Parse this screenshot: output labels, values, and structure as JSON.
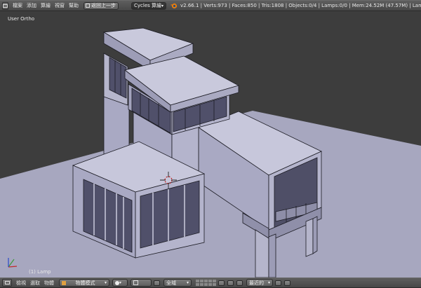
{
  "top_menu": {
    "items": [
      "檔案",
      "添加",
      "算繪",
      "視窗",
      "幫助"
    ],
    "back_label": "返回上一步",
    "engine_label": "Cycles 算繪",
    "stats": "v2.66.1 | Verts:973 | Faces:850 | Tris:1808 | Objects:0/4 | Lamps:0/0 | Mem:24.52M (47.57M) | Lamp"
  },
  "viewport": {
    "view_name": "User Ortho",
    "active_object": "(1) Lamp"
  },
  "bottom_menu": {
    "items": [
      "檢視",
      "選取",
      "物體"
    ],
    "mode_label": "物體模式",
    "global_label": "全域",
    "pivot_label": "最近的"
  },
  "colors": {
    "viewport_bg": "#3d3d3d",
    "ground": "#a7a7bf",
    "header": "#4e4e4e"
  },
  "icons": [
    "editor-type-icon",
    "blender-logo-icon",
    "shading-sphere-icon",
    "manipulator-icon",
    "layer-grid-icon",
    "magnet-icon",
    "camera-icon"
  ]
}
